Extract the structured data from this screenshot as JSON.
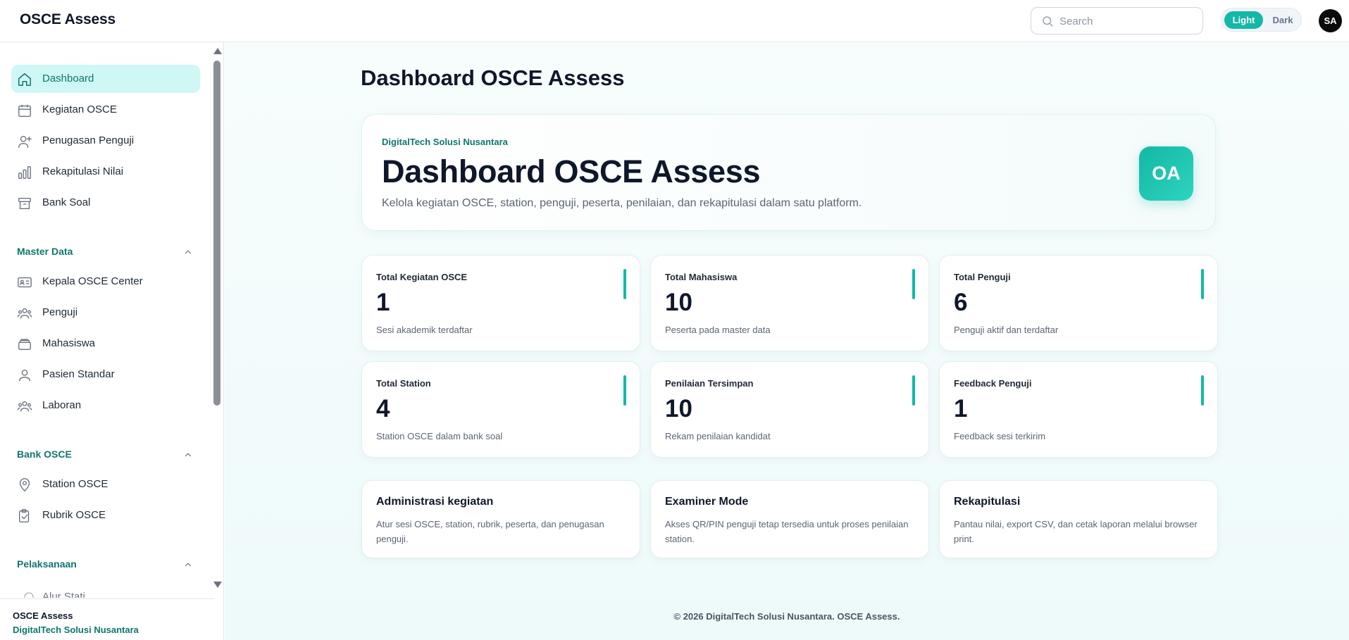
{
  "app": {
    "brand": "OSCE Assess"
  },
  "header": {
    "search_placeholder": "Search",
    "theme": {
      "light": "Light",
      "dark": "Dark",
      "selected": "Light"
    },
    "avatar_initials": "SA",
    "accent_color": "#14b8a6"
  },
  "sidebar": {
    "items": [
      {
        "label": "Dashboard",
        "icon": "home-icon",
        "active": true
      },
      {
        "label": "Kegiatan OSCE",
        "icon": "calendar-icon"
      },
      {
        "label": "Penugasan Penguji",
        "icon": "user-plus-icon"
      },
      {
        "label": "Rekapitulasi Nilai",
        "icon": "bar-chart-icon"
      },
      {
        "label": "Bank Soal",
        "icon": "archive-icon"
      }
    ],
    "sections": [
      {
        "title": "Master Data",
        "items": [
          {
            "label": "Kepala OSCE Center",
            "icon": "id-card-icon"
          },
          {
            "label": "Penguji",
            "icon": "users-icon"
          },
          {
            "label": "Mahasiswa",
            "icon": "layers-icon"
          },
          {
            "label": "Pasien Standar",
            "icon": "user-icon"
          },
          {
            "label": "Laboran",
            "icon": "users-icon"
          }
        ]
      },
      {
        "title": "Bank OSCE",
        "items": [
          {
            "label": "Station OSCE",
            "icon": "map-pin-icon"
          },
          {
            "label": "Rubrik OSCE",
            "icon": "clipboard-check-icon"
          }
        ]
      },
      {
        "title": "Pelaksanaan",
        "items": [
          {
            "label": "Alur Stati...",
            "icon": "route-icon"
          }
        ]
      }
    ],
    "footer": {
      "title": "OSCE Assess",
      "subtitle": "DigitalTech Solusi Nusantara"
    }
  },
  "main": {
    "page_title": "Dashboard OSCE Assess",
    "hero": {
      "company": "DigitalTech Solusi Nusantara",
      "title": "Dashboard OSCE Assess",
      "description": "Kelola kegiatan OSCE, station, penguji, peserta, penilaian, dan rekapitulasi dalam satu platform.",
      "badge": "OA"
    },
    "stats": [
      {
        "label": "Total Kegiatan OSCE",
        "value": "1",
        "desc": "Sesi akademik terdaftar"
      },
      {
        "label": "Total Mahasiswa",
        "value": "10",
        "desc": "Peserta pada master data"
      },
      {
        "label": "Total Penguji",
        "value": "6",
        "desc": "Penguji aktif dan terdaftar"
      },
      {
        "label": "Total Station",
        "value": "4",
        "desc": "Station OSCE dalam bank soal"
      },
      {
        "label": "Penilaian Tersimpan",
        "value": "10",
        "desc": "Rekam penilaian kandidat"
      },
      {
        "label": "Feedback Penguji",
        "value": "1",
        "desc": "Feedback sesi terkirim"
      }
    ],
    "info_cards": [
      {
        "title": "Administrasi kegiatan",
        "desc": "Atur sesi OSCE, station, rubrik, peserta, dan penugasan penguji."
      },
      {
        "title": "Examiner Mode",
        "desc": "Akses QR/PIN penguji tetap tersedia untuk proses penilaian station."
      },
      {
        "title": "Rekapitulasi",
        "desc": "Pantau nilai, export CSV, dan cetak laporan melalui browser print."
      }
    ],
    "footer": "© 2026 DigitalTech Solusi Nusantara. OSCE Assess."
  }
}
